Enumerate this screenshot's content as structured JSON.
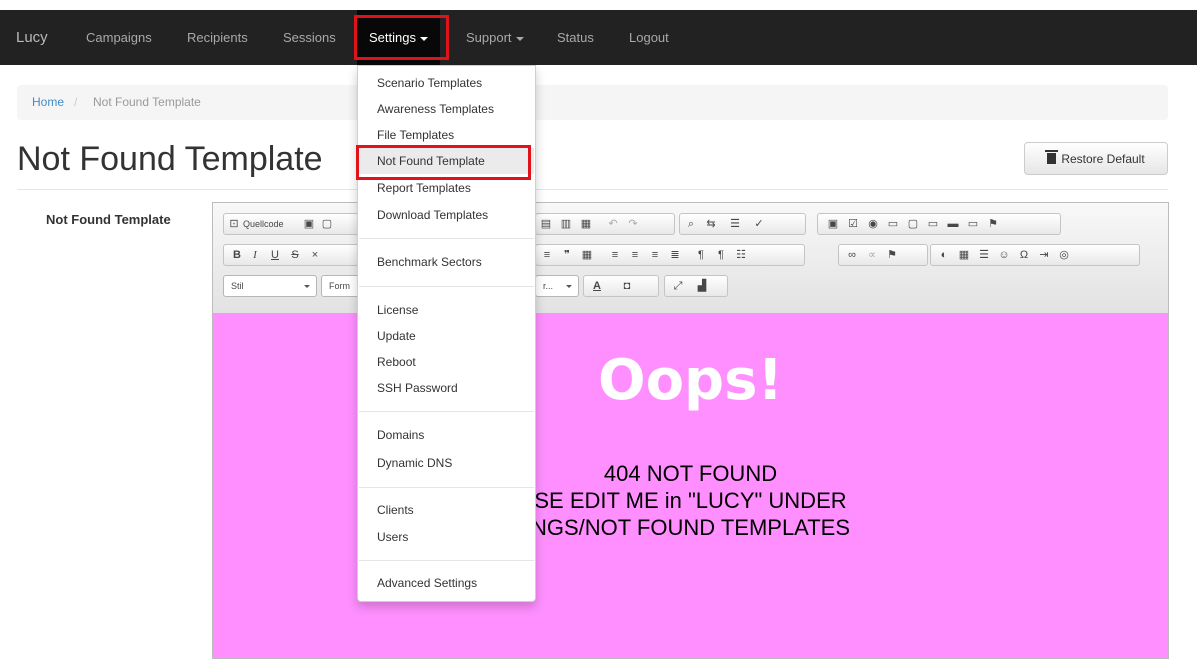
{
  "navbar": {
    "brand": "Lucy",
    "items": [
      {
        "label": "Campaigns"
      },
      {
        "label": "Recipients"
      },
      {
        "label": "Sessions"
      },
      {
        "label": "Settings"
      },
      {
        "label": "Support"
      },
      {
        "label": "Status"
      },
      {
        "label": "Logout"
      }
    ]
  },
  "breadcrumb": {
    "home": "Home",
    "separator": "/",
    "current": "Not Found Template"
  },
  "page": {
    "title": "Not Found Template",
    "restore_label": "Restore Default"
  },
  "form": {
    "label": "Not Found Template"
  },
  "toolbar": {
    "source_label": "Quellcode",
    "style_value": "Stil",
    "format_value": "Form",
    "size_value": "r..."
  },
  "content": {
    "heading": "Oops!",
    "lines": [
      "404 NOT FOUND",
      "SE EDIT ME in \"LUCY\" UNDER",
      "NGS/NOT FOUND TEMPLATES"
    ]
  },
  "settings_menu": {
    "items": [
      "Scenario Templates",
      "Awareness Templates",
      "File Templates",
      "Not Found Template",
      "Report Templates",
      "Download Templates",
      "Benchmark Sectors",
      "License",
      "Update",
      "Reboot",
      "SSH Password",
      "Domains",
      "Dynamic DNS",
      "Clients",
      "Users",
      "Advanced Settings"
    ],
    "active": "Not Found Template"
  },
  "colors": {
    "navbar": "#222222",
    "highlight": "#e0121a",
    "content_bg": "#ff8fff",
    "link": "#428bca"
  }
}
